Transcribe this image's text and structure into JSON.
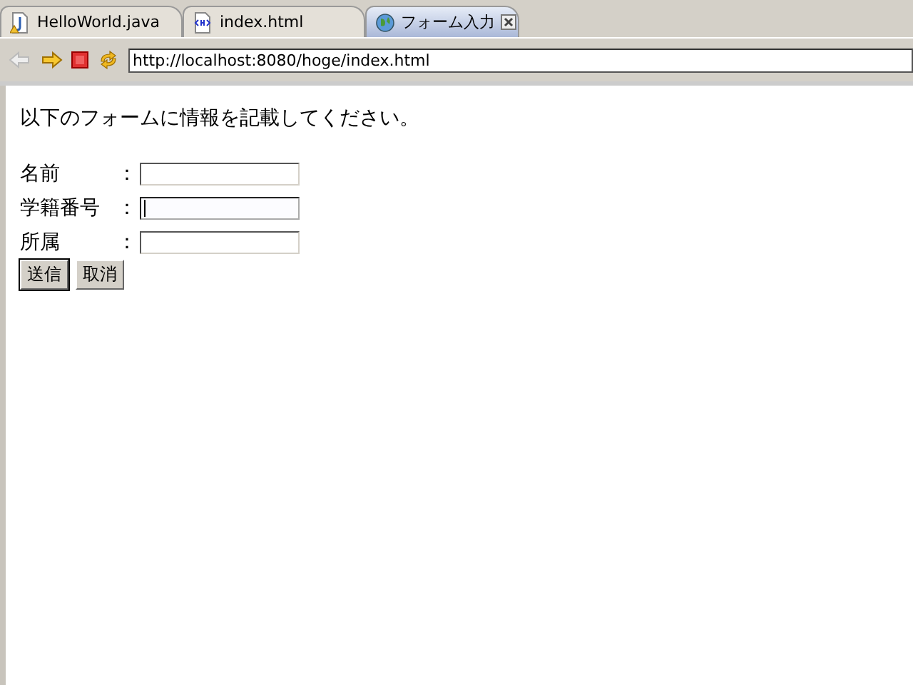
{
  "tabs": [
    {
      "label": "HelloWorld.java",
      "kind": "java",
      "selected": false
    },
    {
      "label": "index.html",
      "kind": "html",
      "selected": false
    },
    {
      "label": "フォーム入力",
      "kind": "web",
      "selected": true
    }
  ],
  "address": {
    "value": "http://localhost:8080/hoge/index.html"
  },
  "page": {
    "intro": "以下のフォームに情報を記載してください。",
    "fields": [
      {
        "label": "名前",
        "colon": "：",
        "focused": false
      },
      {
        "label": "学籍番号",
        "colon": "：",
        "focused": true
      },
      {
        "label": "所属",
        "colon": "：",
        "focused": false
      }
    ],
    "buttons": [
      {
        "label": "送信",
        "selected": true
      },
      {
        "label": "取消",
        "selected": false
      }
    ]
  }
}
